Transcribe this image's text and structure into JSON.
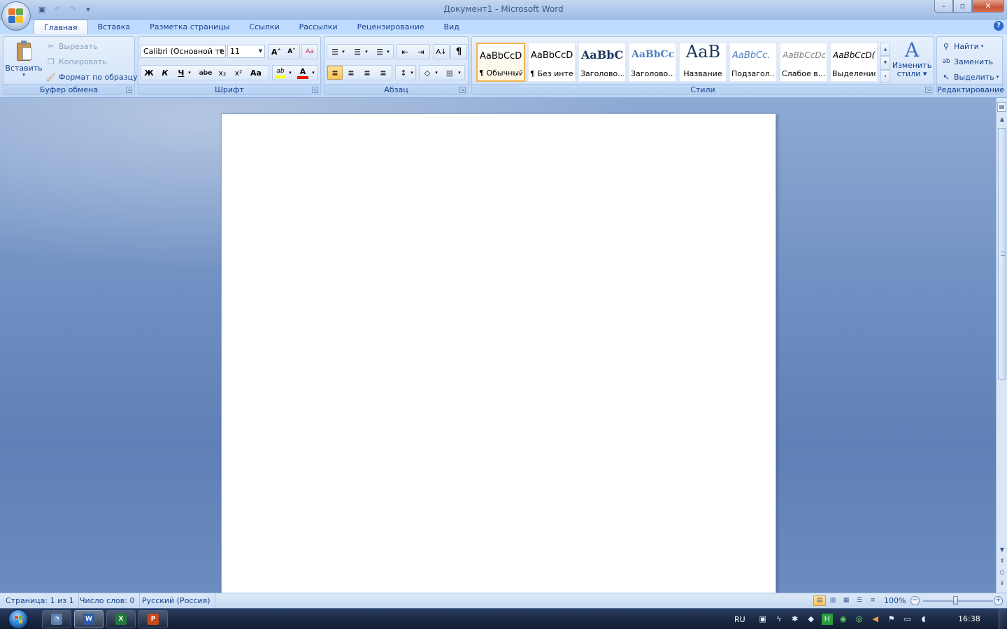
{
  "window": {
    "title": "Документ1 - Microsoft Word",
    "minimize": "–",
    "maximize": "▫",
    "close": "✕"
  },
  "qat": {
    "save": "💾",
    "undo": "↶",
    "redo": "↷",
    "customize": "▾"
  },
  "tabs": [
    {
      "label": "Главная",
      "active": true
    },
    {
      "label": "Вставка"
    },
    {
      "label": "Разметка страницы"
    },
    {
      "label": "Ссылки"
    },
    {
      "label": "Рассылки"
    },
    {
      "label": "Рецензирование"
    },
    {
      "label": "Вид"
    }
  ],
  "help": "?",
  "clipboard": {
    "group": "Буфер обмена",
    "paste": "Вставить",
    "cut": "Вырезать",
    "copy": "Копировать",
    "format_painter": "Формат по образцу"
  },
  "font": {
    "group": "Шрифт",
    "name": "Calibri (Основной те",
    "size": "11",
    "grow": "A˄",
    "shrink": "A˅",
    "clear": "Aa",
    "bold": "Ж",
    "italic": "К",
    "underline": "Ч",
    "strike": "abe",
    "subscript": "x₂",
    "superscript": "x²",
    "case": "Aa",
    "highlight": "ab",
    "font_color": "A",
    "highlight_color": "#ffff00",
    "font_color_value": "#ff0000"
  },
  "paragraph": {
    "group": "Абзац",
    "bullets": "☰",
    "numbering": "☰",
    "multilevel": "☰",
    "decrease_indent": "⇤",
    "increase_indent": "⇥",
    "sort": "A↓",
    "show_marks": "¶",
    "align_left": "≡",
    "align_center": "≡",
    "align_right": "≡",
    "justify": "≡",
    "line_spacing": "↕",
    "shading": "◇",
    "borders": "▦"
  },
  "styles": {
    "group": "Стили",
    "items": [
      {
        "sample": "AaBbCcDc",
        "name": "¶ Обычный",
        "selected": true
      },
      {
        "sample": "AaBbCcDc",
        "name": "¶ Без инте..."
      },
      {
        "sample": "AaBbC(",
        "name": "Заголово..."
      },
      {
        "sample": "AaBbCc",
        "name": "Заголово..."
      },
      {
        "sample": "AaB",
        "name": "Название"
      },
      {
        "sample": "AaBbCc.",
        "name": "Подзагол..."
      },
      {
        "sample": "AaBbCcDc",
        "name": "Слабое в..."
      },
      {
        "sample": "AaBbCcD(",
        "name": "Выделение"
      }
    ],
    "change_styles_line1": "Изменить",
    "change_styles_line2": "стили"
  },
  "editing": {
    "group": "Редактирование",
    "find": "Найти",
    "replace": "Заменить",
    "select": "Выделить"
  },
  "status": {
    "page": "Страница: 1 из 1",
    "words": "Число слов: 0",
    "language": "Русский (Россия)",
    "zoom": "100%"
  },
  "taskbar": {
    "lang": "RU",
    "time": "16:38",
    "apps": [
      {
        "name": "explorer",
        "label": "◔",
        "color": "#5b7fb0"
      },
      {
        "name": "word",
        "label": "W",
        "color": "#2b5aa8"
      },
      {
        "name": "excel",
        "label": "X",
        "color": "#1f7a3c"
      },
      {
        "name": "powerpoint",
        "label": "P",
        "color": "#c8481e"
      }
    ]
  }
}
